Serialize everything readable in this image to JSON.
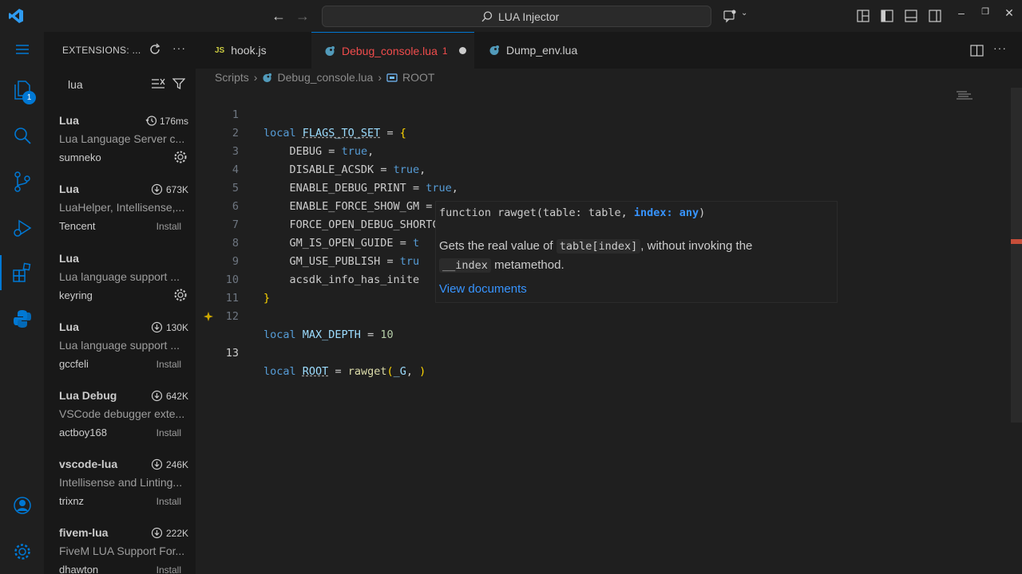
{
  "titlebar": {
    "command_center": "LUA Injector"
  },
  "activity": {
    "explorer_badge": "1"
  },
  "sidebar": {
    "title": "EXTENSIONS: ...",
    "search_value": "lua",
    "extensions": [
      {
        "name": "Lua",
        "stat": "176ms",
        "stat_icon": "history-icon",
        "desc": "Lua Language Server c...",
        "publisher": "sumneko",
        "action": "gear"
      },
      {
        "name": "Lua",
        "stat": "673K",
        "stat_icon": "cloud-download-icon",
        "desc": "LuaHelper, Intellisense,...",
        "publisher": "Tencent",
        "action": "Install"
      },
      {
        "name": "Lua",
        "stat": "",
        "stat_icon": "",
        "desc": "Lua language support ...",
        "publisher": "keyring",
        "action": "gear"
      },
      {
        "name": "Lua",
        "stat": "130K",
        "stat_icon": "cloud-download-icon",
        "desc": "Lua language support ...",
        "publisher": "gccfeli",
        "action": "Install"
      },
      {
        "name": "Lua Debug",
        "stat": "642K",
        "stat_icon": "cloud-download-icon",
        "desc": "VSCode debugger exte...",
        "publisher": "actboy168",
        "action": "Install"
      },
      {
        "name": "vscode-lua",
        "stat": "246K",
        "stat_icon": "cloud-download-icon",
        "desc": "Intellisense and Linting...",
        "publisher": "trixnz",
        "action": "Install"
      },
      {
        "name": "fivem-lua",
        "stat": "222K",
        "stat_icon": "cloud-download-icon",
        "desc": "FiveM LUA Support For...",
        "publisher": "dhawton",
        "action": "Install"
      }
    ]
  },
  "tabs": [
    {
      "icon": "JS",
      "label": "hook.js",
      "active": false
    },
    {
      "icon": "lua",
      "label": "Debug_console.lua",
      "badge": "1",
      "active": true,
      "dirty": true
    },
    {
      "icon": "lua",
      "label": "Dump_env.lua",
      "active": false
    }
  ],
  "breadcrumb": [
    "Scripts",
    "Debug_console.lua",
    "ROOT"
  ],
  "code": {
    "line_numbers": [
      "1",
      "2",
      "3",
      "4",
      "5",
      "6",
      "7",
      "8",
      "9",
      "10",
      "11",
      "12",
      "13"
    ],
    "fields": [
      "DEBUG",
      "DISABLE_ACSDK",
      "ENABLE_DEBUG_PRINT",
      "ENABLE_FORCE_SHOW_GM",
      "FORCE_OPEN_DEBUG_SHORTCUT",
      "GM_IS_OPEN_GUIDE",
      "GM_USE_PUBLISH",
      "acsdk_info_has_inite"
    ],
    "partial_values": [
      "t",
      "tru"
    ],
    "flags_name": "FLAGS_TO_SET",
    "max_depth_name": "MAX_DEPTH",
    "max_depth_value": "10",
    "root_name": "ROOT",
    "call_fn": "rawget",
    "call_arg": "_G"
  },
  "hover": {
    "signature_prefix": "function rawget(table: table, ",
    "signature_param": "index: any",
    "signature_suffix": ")",
    "doc_pre": "Gets the real value of ",
    "doc_code1": "table[index]",
    "doc_mid": ", without invoking the",
    "doc_code2": "__index",
    "doc_post": " metamethod.",
    "link": "View documents"
  },
  "colors": {
    "accent": "#0078d4",
    "error_tab": "#f14c4c",
    "link": "#3794ff"
  }
}
